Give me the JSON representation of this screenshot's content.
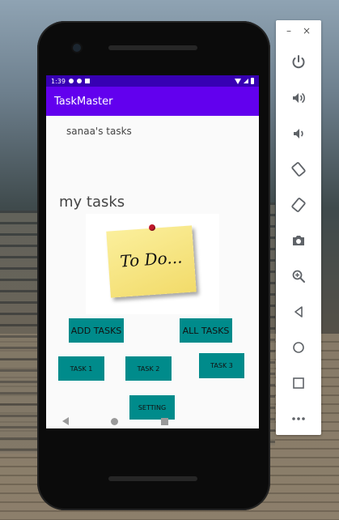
{
  "window": {
    "minimize_label": "–",
    "close_label": "×"
  },
  "status_bar": {
    "time": "1:39"
  },
  "app_bar": {
    "title": "TaskMaster"
  },
  "main": {
    "user_tasks_label": "sanaa's tasks",
    "section_title": "my tasks",
    "todo_image_text": "To Do...",
    "buttons": {
      "add_tasks": "ADD TASKS",
      "all_tasks": "ALL TASKS",
      "task1": "TASK 1",
      "task2": "TASK 2",
      "task3": "TASK 3",
      "setting": "SETTING"
    }
  },
  "colors": {
    "status_bar": "#3700b3",
    "app_bar": "#6200ee",
    "button": "#008b8b"
  },
  "toolbar": {
    "icons": [
      "power-icon",
      "volume-up-icon",
      "volume-down-icon",
      "rotate-left-icon",
      "rotate-right-icon",
      "camera-icon",
      "zoom-icon",
      "back-icon",
      "home-icon",
      "overview-icon",
      "more-icon"
    ]
  }
}
